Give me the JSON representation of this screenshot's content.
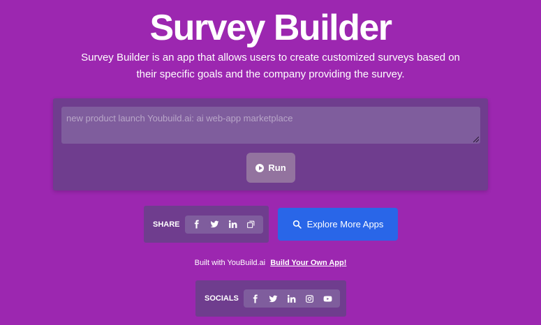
{
  "header": {
    "title": "Survey Builder",
    "description": "Survey Builder is an app that allows users to create customized surveys based on their specific goals and the company providing the survey."
  },
  "form": {
    "prompt_value": "new product launch Youbuild.ai: ai web-app marketplace",
    "run_label": "Run"
  },
  "share": {
    "label": "SHARE",
    "icons": [
      "facebook-icon",
      "twitter-icon",
      "linkedin-icon",
      "copy-link-icon"
    ]
  },
  "explore": {
    "label": "Explore More Apps"
  },
  "footer": {
    "built_text": "Built with YouBuild.ai",
    "build_link": "Build Your Own App!"
  },
  "socials": {
    "label": "SOCIALS",
    "icons": [
      "facebook-icon",
      "twitter-icon",
      "linkedin-icon",
      "instagram-icon",
      "youtube-icon"
    ]
  },
  "colors": {
    "background": "#9c27b0",
    "panel": "#6f3d8e",
    "accent_button": "#2966e8"
  }
}
